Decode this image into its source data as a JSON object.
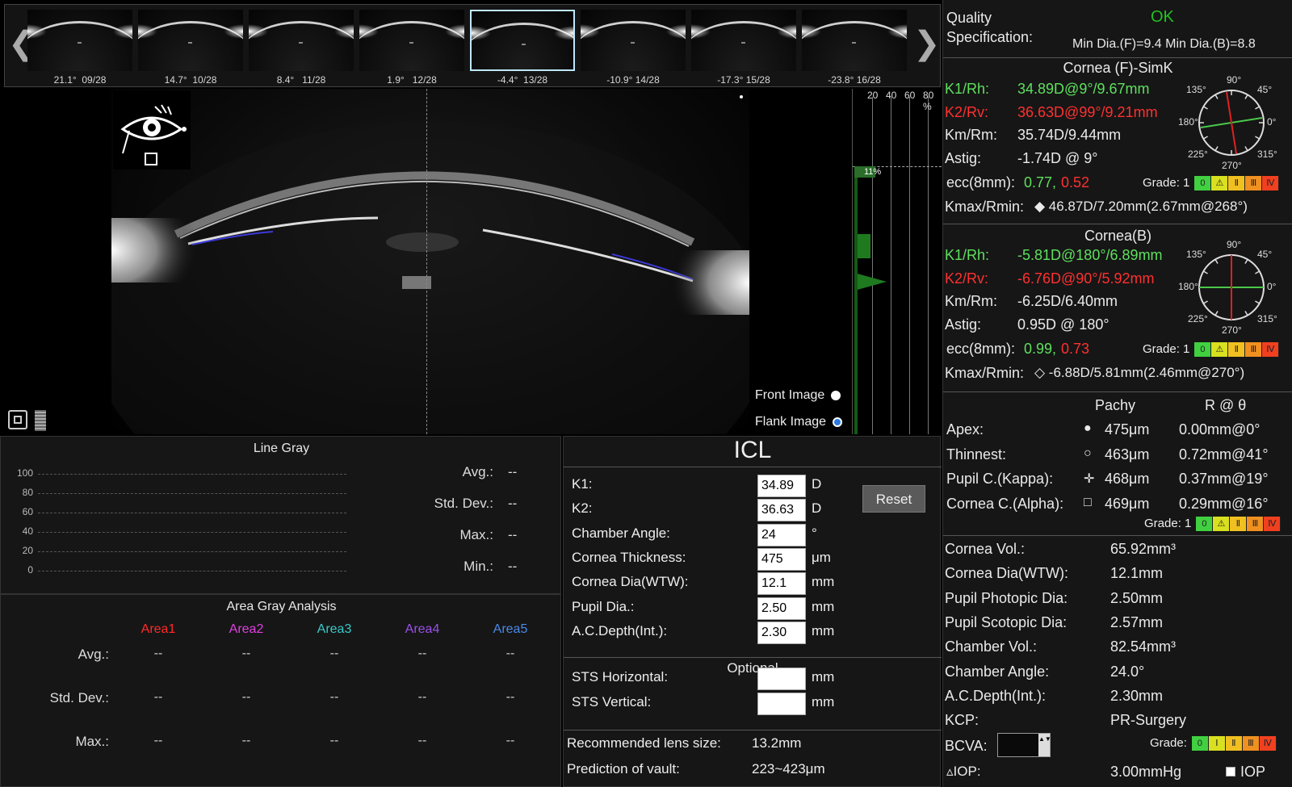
{
  "thumbnails": [
    {
      "label": "21.1°  09/28"
    },
    {
      "label": "14.7°  10/28"
    },
    {
      "label": "8.4°   11/28"
    },
    {
      "label": "1.9°   12/28"
    },
    {
      "label": "-4.4°  13/28",
      "selected": true
    },
    {
      "label": "-10.9° 14/28"
    },
    {
      "label": "-17.3° 15/28"
    },
    {
      "label": "-23.8° 16/28"
    }
  ],
  "nav": {
    "prev": "❮",
    "next": "❯"
  },
  "histogram": {
    "ticks": [
      "20",
      "40",
      "60",
      "80 %"
    ],
    "marker": "11%"
  },
  "image_mode": {
    "front_label": "Front Image",
    "flank_label": "Flank Image",
    "selected": "flank"
  },
  "line_gray": {
    "title": "Line Gray",
    "y_ticks": [
      "100",
      "80",
      "60",
      "40",
      "20",
      "0"
    ],
    "stats": [
      {
        "label": "Avg.:",
        "value": "--"
      },
      {
        "label": "Std. Dev.:",
        "value": "--"
      },
      {
        "label": "Max.:",
        "value": "--"
      },
      {
        "label": "Min.:",
        "value": "--"
      }
    ]
  },
  "area_gray": {
    "title": "Area Gray Analysis",
    "areas": [
      {
        "name": "Area1",
        "color": "#ff2a2a"
      },
      {
        "name": "Area2",
        "color": "#e040e0"
      },
      {
        "name": "Area3",
        "color": "#3cc8c8"
      },
      {
        "name": "Area4",
        "color": "#9a50e8"
      },
      {
        "name": "Area5",
        "color": "#4a8ae8"
      }
    ],
    "rows": [
      {
        "label": "Avg.:",
        "values": [
          "--",
          "--",
          "--",
          "--",
          "--"
        ]
      },
      {
        "label": "Std. Dev.:",
        "values": [
          "--",
          "--",
          "--",
          "--",
          "--"
        ]
      },
      {
        "label": "Max.:",
        "values": [
          "--",
          "--",
          "--",
          "--",
          "--"
        ]
      }
    ]
  },
  "icl": {
    "title": "ICL",
    "reset_label": "Reset",
    "fields": [
      {
        "label": "K1:",
        "value": "34.89",
        "unit": "D"
      },
      {
        "label": "K2:",
        "value": "36.63",
        "unit": "D"
      },
      {
        "label": "Chamber Angle:",
        "value": "24",
        "unit": "°"
      },
      {
        "label": "Cornea Thickness:",
        "value": "475",
        "unit": "μm"
      },
      {
        "label": "Cornea Dia(WTW):",
        "value": "12.1",
        "unit": "mm"
      },
      {
        "label": "Pupil Dia.:",
        "value": "2.50",
        "unit": "mm"
      },
      {
        "label": "A.C.Depth(Int.):",
        "value": "2.30",
        "unit": "mm"
      }
    ],
    "optional_title": "Optional",
    "optional": [
      {
        "label": "STS Horizontal:",
        "value": "",
        "unit": "mm"
      },
      {
        "label": "STS Vertical:",
        "value": "",
        "unit": "mm"
      }
    ],
    "results": [
      {
        "label": "Recommended lens size:",
        "value": "13.2mm"
      },
      {
        "label": "Prediction of vault:",
        "value": "223~423μm"
      }
    ]
  },
  "quality": {
    "label_line1": "Quality",
    "label_line2": "Specification:",
    "status": "OK",
    "status_color": "#22c022",
    "min_dia": "Min Dia.(F)=9.4  Min Dia.(B)=8.8"
  },
  "cornea_f": {
    "title": "Cornea (F)-SimK",
    "k1": {
      "label": "K1/Rh:",
      "value": "34.89D@9°/9.67mm"
    },
    "k2": {
      "label": "K2/Rv:",
      "value": "36.63D@99°/9.21mm"
    },
    "km": {
      "label": "Km/Rm:",
      "value": "35.74D/9.44mm"
    },
    "astig": {
      "label": "Astig:",
      "value": "-1.74D @ 9°"
    },
    "ecc": {
      "label": "ecc(8mm):",
      "v1": "0.77,",
      "v2": "0.52"
    },
    "grade": "Grade: 1",
    "kmax": {
      "label": "Kmax/Rmin:",
      "value": "◆ 46.87D/7.20mm(2.67mm@268°)"
    },
    "dial": {
      "t90": "90°",
      "t45": "45°",
      "t0": "0°",
      "t135": "135°",
      "t180": "180°",
      "t225": "225°",
      "t270": "270°",
      "t315": "315°"
    }
  },
  "cornea_b": {
    "title": "Cornea(B)",
    "k1": {
      "label": "K1/Rh:",
      "value": "-5.81D@180°/6.89mm"
    },
    "k2": {
      "label": "K2/Rv:",
      "value": "-6.76D@90°/5.92mm"
    },
    "km": {
      "label": "Km/Rm:",
      "value": "-6.25D/6.40mm"
    },
    "astig": {
      "label": "Astig:",
      "value": "0.95D @ 180°"
    },
    "ecc": {
      "label": "ecc(8mm):",
      "v1": "0.99,",
      "v2": "0.73"
    },
    "grade": "Grade: 1",
    "kmax": {
      "label": "Kmax/Rmin:",
      "value": "◇ -6.88D/5.81mm(2.46mm@270°)"
    }
  },
  "pachy": {
    "col1": "Pachy",
    "col2": "R @ θ",
    "rows": [
      {
        "label": "Apex:",
        "symbol": "●",
        "pachy": "475μm",
        "r": "0.00mm@0°"
      },
      {
        "label": "Thinnest:",
        "symbol": "○",
        "pachy": "463μm",
        "r": "0.72mm@41°"
      },
      {
        "label": "Pupil C.(Kappa):",
        "symbol": "✛",
        "pachy": "468μm",
        "r": "0.37mm@19°"
      },
      {
        "label": "Cornea C.(Alpha):",
        "symbol": "□",
        "pachy": "469μm",
        "r": "0.29mm@16°"
      }
    ],
    "grade": "Grade: 1"
  },
  "summary": {
    "rows": [
      {
        "label": "Cornea Vol.:",
        "value": "65.92mm³"
      },
      {
        "label": "Cornea Dia(WTW):",
        "value": "12.1mm"
      },
      {
        "label": "Pupil Photopic Dia:",
        "value": "2.50mm"
      },
      {
        "label": "Pupil Scotopic Dia:",
        "value": "2.57mm"
      },
      {
        "label": "Chamber Vol.:",
        "value": "82.54mm³"
      },
      {
        "label": "Chamber Angle:",
        "value": "24.0°"
      },
      {
        "label": "A.C.Depth(Int.):",
        "value": "2.30mm"
      },
      {
        "label": "KCP:",
        "value": "PR-Surgery"
      }
    ],
    "bcva_label": "BCVA:",
    "grade_label": "Grade:",
    "iop_label": "▵IOP:",
    "iop_value": "3.00mmHg",
    "iop_check_label": "IOP"
  },
  "grade_cells": [
    "0",
    "⚠",
    "Ⅱ",
    "Ⅲ",
    "Ⅳ"
  ],
  "grade_cells_kcp": [
    "0",
    "Ⅰ",
    "Ⅱ",
    "Ⅲ",
    "Ⅳ"
  ],
  "grade_colors": [
    "#40d040",
    "#d8e020",
    "#f0c020",
    "#f09020",
    "#f04020"
  ]
}
